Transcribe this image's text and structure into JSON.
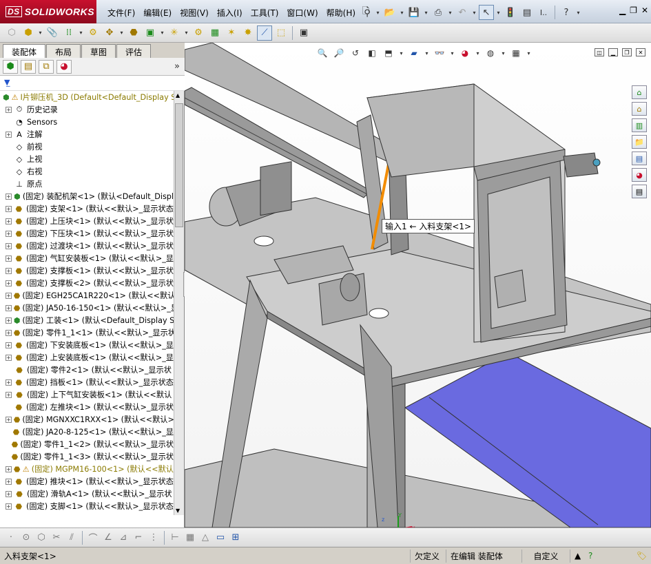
{
  "app": {
    "brand": "SOLIDWORKS",
    "brand_prefix": "DS"
  },
  "menu": [
    "文件(F)",
    "编辑(E)",
    "视图(V)",
    "插入(I)",
    "工具(T)",
    "窗口(W)",
    "帮助(H)"
  ],
  "top_extra": {
    "search_hint": "I.."
  },
  "tabs": [
    "装配体",
    "布局",
    "草图",
    "评估"
  ],
  "filter_icon": "filter-icon",
  "tree": {
    "root": "I片铆压机_3D  (Default<Default_Display S",
    "items": [
      {
        "label": "历史记录",
        "icon": "history",
        "exp": true
      },
      {
        "label": "Sensors",
        "icon": "sensor",
        "exp": false
      },
      {
        "label": "注解",
        "icon": "annot",
        "exp": true
      },
      {
        "label": "前视",
        "icon": "plane",
        "exp": false
      },
      {
        "label": "上视",
        "icon": "plane",
        "exp": false
      },
      {
        "label": "右视",
        "icon": "plane",
        "exp": false
      },
      {
        "label": "原点",
        "icon": "origin",
        "exp": false
      },
      {
        "label": "(固定) 装配机架<1> (默认<Default_Displ",
        "icon": "asm",
        "exp": true
      },
      {
        "label": "(固定) 支架<1> (默认<<默认>_显示状态",
        "icon": "part",
        "exp": true
      },
      {
        "label": "(固定) 上压块<1> (默认<<默认>_显示状",
        "icon": "part",
        "exp": true
      },
      {
        "label": "(固定) 下压块<1> (默认<<默认>_显示状",
        "icon": "part",
        "exp": true
      },
      {
        "label": "(固定) 过渡块<1> (默认<<默认>_显示状",
        "icon": "part",
        "exp": true
      },
      {
        "label": "(固定) 气缸安装板<1> (默认<<默认>_显",
        "icon": "part",
        "exp": true
      },
      {
        "label": "(固定) 支撑板<1> (默认<<默认>_显示状",
        "icon": "part",
        "exp": true
      },
      {
        "label": "(固定) 支撑板<2> (默认<<默认>_显示状",
        "icon": "part",
        "exp": true
      },
      {
        "label": "(固定) EGH25CA1R220<1> (默认<<默认>_显",
        "icon": "part",
        "exp": true
      },
      {
        "label": "(固定) JA50-16-150<1> (默认<<默认>_显",
        "icon": "part",
        "exp": true
      },
      {
        "label": "(固定) 工装<1> (默认<Default_Display St",
        "icon": "asm",
        "exp": true
      },
      {
        "label": "(固定) 零件1_1<1> (默认<<默认>_显示状",
        "icon": "part",
        "exp": true
      },
      {
        "label": "(固定) 下安装底板<1> (默认<<默认>_显",
        "icon": "part",
        "exp": true
      },
      {
        "label": "(固定) 上安装底板<1> (默认<<默认>_显",
        "icon": "part",
        "exp": true
      },
      {
        "label": "(固定) 零件2<1> (默认<<默认>_显示状",
        "icon": "part",
        "exp": false
      },
      {
        "label": "(固定) 挡板<1> (默认<<默认>_显示状态",
        "icon": "part",
        "exp": true
      },
      {
        "label": "(固定) 上下气缸安装板<1> (默认<<默认",
        "icon": "part",
        "exp": true
      },
      {
        "label": "(固定) 左推块<1> (默认<<默认>_显示状",
        "icon": "part",
        "exp": false
      },
      {
        "label": "(固定) MGNXXC1RXX<1> (默认<<默认>_",
        "icon": "part",
        "exp": true
      },
      {
        "label": "(固定) JA20-8-125<1> (默认<<默认>_显",
        "icon": "part",
        "exp": false
      },
      {
        "label": "(固定) 零件1_1<2> (默认<<默认>_显示状",
        "icon": "part",
        "exp": false
      },
      {
        "label": "(固定) 零件1_1<3> (默认<<默认>_显示状",
        "icon": "part",
        "exp": false
      },
      {
        "label": "(固定) MGPM16-100<1> (默认<<默认",
        "icon": "warn",
        "exp": true
      },
      {
        "label": "(固定) 推块<1> (默认<<默认>_显示状态",
        "icon": "part",
        "exp": true
      },
      {
        "label": "(固定) 滑轨A<1> (默认<<默认>_显示状",
        "icon": "part",
        "exp": true
      },
      {
        "label": "(固定) 支脚<1> (默认<<默认>_显示状态",
        "icon": "part",
        "exp": true
      }
    ]
  },
  "callout": "输入1 ← 入料支架<1>",
  "status": {
    "selection": "入料支架<1>",
    "definition": "欠定义",
    "mode": "在编辑 装配体",
    "units": "自定义"
  },
  "colors": {
    "accent_orange": "#f28c00",
    "belt_blue": "#6666dd",
    "brand_red": "#c8102e"
  }
}
